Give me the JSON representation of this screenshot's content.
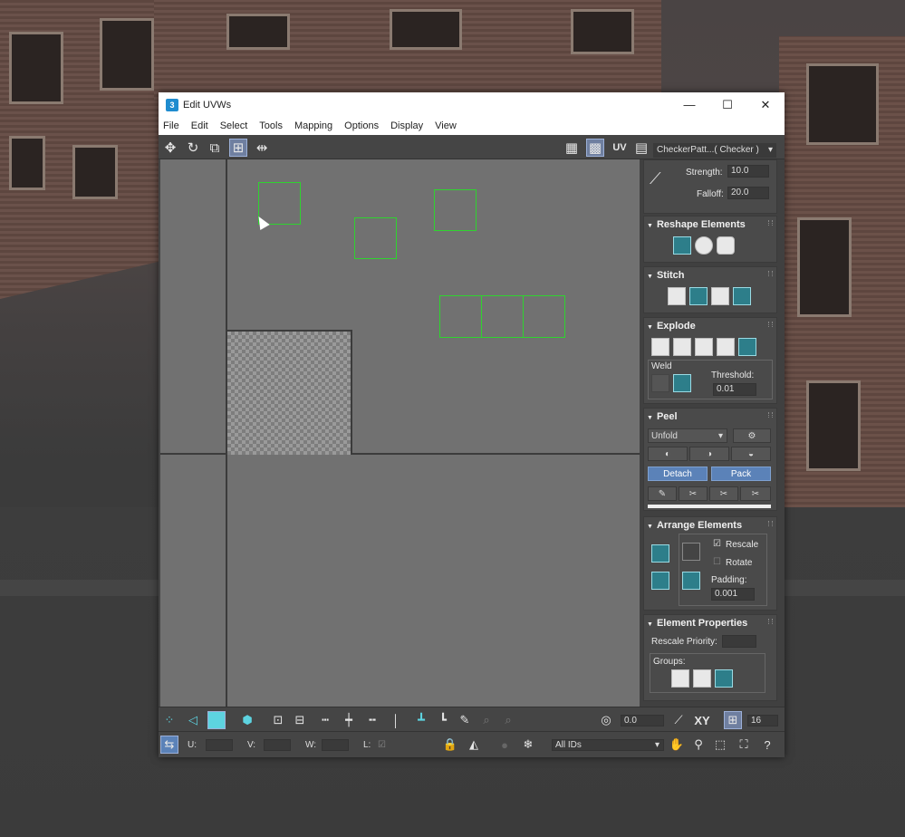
{
  "window": {
    "title": "Edit UVWs",
    "minimize": "—",
    "maximize": "☐",
    "close": "✕"
  },
  "menu": [
    "File",
    "Edit",
    "Select",
    "Tools",
    "Mapping",
    "Options",
    "Display",
    "View"
  ],
  "toolbar": {
    "uv_label": "UV",
    "checker_dropdown": "CheckerPatt...( Checker )"
  },
  "panel": {
    "softsel": {
      "strength_label": "Strength:",
      "strength_value": "10.0",
      "falloff_label": "Falloff:",
      "falloff_value": "20.0"
    },
    "reshape": {
      "title": "Reshape Elements"
    },
    "stitch": {
      "title": "Stitch"
    },
    "explode": {
      "title": "Explode",
      "weld_label": "Weld",
      "threshold_label": "Threshold:",
      "threshold_value": "0.01"
    },
    "peel": {
      "title": "Peel",
      "mode": "Unfold",
      "detach": "Detach",
      "pack": "Pack"
    },
    "arrange": {
      "title": "Arrange Elements",
      "rescale": "Rescale",
      "rotate": "Rotate",
      "padding_label": "Padding:",
      "padding_value": "0.001"
    },
    "element_props": {
      "title": "Element Properties",
      "rescale_priority": "Rescale Priority:",
      "groups": "Groups:"
    }
  },
  "bottom": {
    "angle_value": "0.0",
    "xy_label": "XY",
    "grid_value": "16",
    "u_label": "U:",
    "v_label": "V:",
    "w_label": "W:",
    "l_label": "L:",
    "ids_dropdown": "All IDs"
  },
  "colors": {
    "selection_green": "#2fd32f",
    "accent_teal": "#2d7e8a",
    "button_blue": "#5b82b8"
  }
}
